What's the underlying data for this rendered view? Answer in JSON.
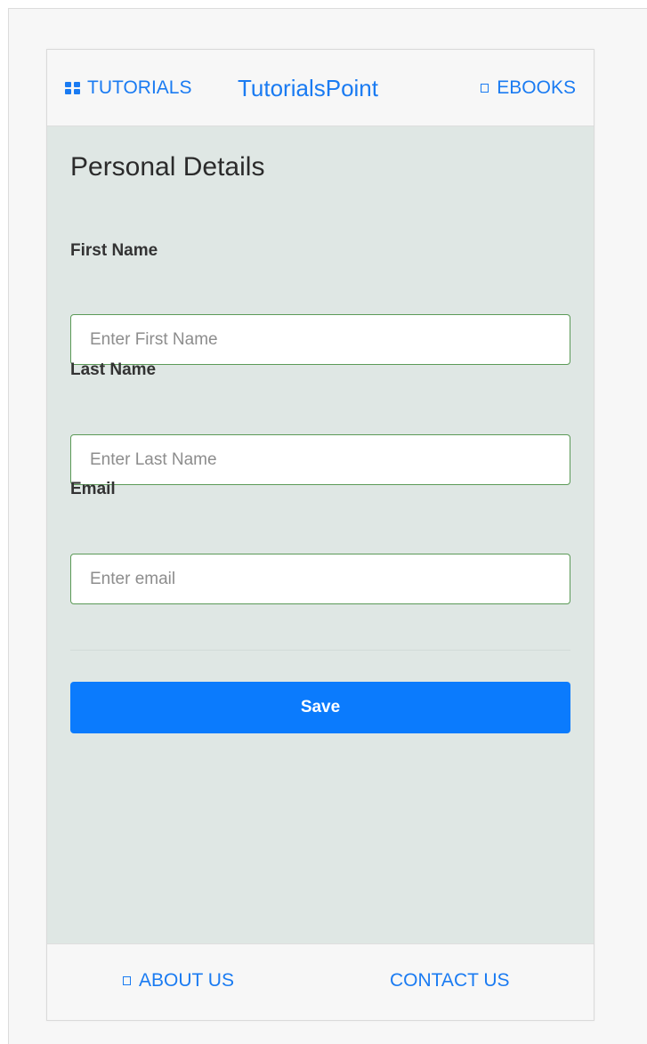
{
  "header": {
    "left_link_label": "TUTORIALS",
    "left_link_icon": "grid-icon",
    "title": "TutorialsPoint",
    "right_link_label": "EBOOKS",
    "right_link_icon": "book-icon"
  },
  "form": {
    "heading": "Personal Details",
    "fields": [
      {
        "label": "First Name",
        "placeholder": "Enter First Name",
        "value": ""
      },
      {
        "label": "Last Name",
        "placeholder": "Enter Last Name",
        "value": ""
      },
      {
        "label": "Email",
        "placeholder": "Enter email",
        "value": ""
      }
    ],
    "save_label": "Save"
  },
  "footer": {
    "about_label": "ABOUT US",
    "about_icon": "info-icon",
    "contact_label": "CONTACT US"
  },
  "colors": {
    "accent": "#1a7bf2",
    "button": "#0b7bfd",
    "content_bg": "#dfe7e4",
    "input_border": "#5b9a57"
  }
}
